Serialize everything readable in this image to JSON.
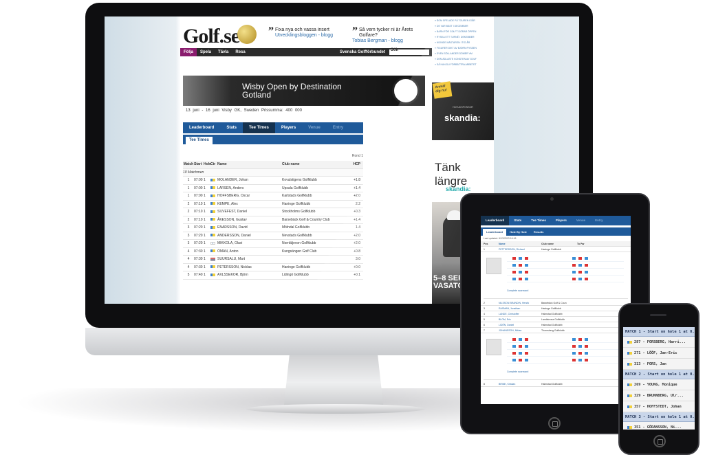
{
  "desktop": {
    "logo": "Golf.se",
    "quotes": [
      {
        "text": "Fixa nya och vassa insert",
        "sub": "Utvecklingsbloggen - blogg"
      },
      {
        "text": "Så vem tycker ni är Årets Golfare?",
        "sub": "Tobias Bergman - blogg"
      }
    ],
    "nav": [
      "Följa",
      "Spela",
      "Tävla",
      "Resa"
    ],
    "nav_right": "Svenska Golfförbundet",
    "search_placeholder": "Sök",
    "banner_title": "Wisby Open by Destination Gotland",
    "event_info": "13 juni - 16 juni    Visby GK, Sweden    Prissumma: 400 000",
    "tabs": [
      "Leaderboard",
      "Stats",
      "Tee Times",
      "Players",
      "Venue",
      "Entry"
    ],
    "active_tab": "Tee Times",
    "subtab": "Tee Times",
    "pager": "Rond 1",
    "columns": [
      "Match",
      "Start",
      "Hole",
      "Ctr",
      "Name",
      "Club name",
      "HCP"
    ],
    "group_label": "10 Matchmen",
    "rows": [
      {
        "match": "1",
        "start": "07:00",
        "hole": "1",
        "name": "MOLANDER, Johan",
        "club": "Kovulstigens Golfklubb",
        "hcp": "+1.8"
      },
      {
        "match": "1",
        "start": "07:00",
        "hole": "1",
        "name": "LARSEN, Anders",
        "club": "Upsala Golfklubb",
        "hcp": "+1.4"
      },
      {
        "match": "1",
        "start": "07:00",
        "hole": "1",
        "name": "HOFFSBERG, Oscar",
        "club": "Karlstads Golfklubb",
        "hcp": "+2.0"
      },
      {
        "match": "2",
        "start": "07:10",
        "hole": "1",
        "name": "KEMPE, Alex",
        "club": "Haninge Golfklubb",
        "hcp": "2.2"
      },
      {
        "match": "2",
        "start": "07:10",
        "hole": "1",
        "name": "SILVEFEST, Daniel",
        "club": "Stockholms Golfklubb",
        "hcp": "+0.3"
      },
      {
        "match": "2",
        "start": "07:10",
        "hole": "1",
        "name": "ÅKESSON, Gustav",
        "club": "Barsebäck Golf & Country Club",
        "hcp": "+1.4"
      },
      {
        "match": "3",
        "start": "07:20",
        "hole": "1",
        "name": "ENARSSON, David",
        "club": "Mölndal Golfklubb",
        "hcp": "1.4"
      },
      {
        "match": "3",
        "start": "07:20",
        "hole": "1",
        "name": "ANDERSSON, Daniel",
        "club": "Nevstads Golfklubb",
        "hcp": "+2.0"
      },
      {
        "match": "3",
        "start": "07:20",
        "hole": "1",
        "name": "MIKKOLA, Olavi",
        "club": "Norrtäljevon Golfklubb",
        "hcp": "+2.0"
      },
      {
        "match": "4",
        "start": "07:30",
        "hole": "1",
        "name": "ÖMAN, Anton",
        "club": "Kungsängen Golf Club",
        "hcp": "+0.8"
      },
      {
        "match": "4",
        "start": "07:30",
        "hole": "1",
        "name": "SUURSALU, Mart",
        "club": "",
        "hcp": "3.0"
      },
      {
        "match": "4",
        "start": "07:30",
        "hole": "1",
        "name": "PETERSSON, Nicklas",
        "club": "Haninge Golfklubb",
        "hcp": "+0.0"
      },
      {
        "match": "5",
        "start": "07:40",
        "hole": "1",
        "name": "AXLSSEKOR, Björn",
        "club": "Lidingö Golfklubb",
        "hcp": "+0.1"
      }
    ],
    "right_links": [
      "SOM SPELADE PÅ TOUREN IGÅR",
      "DE VAR BÄST I DECEMBER",
      "BARN FÖR GOLFT DÖRAR ÖPPEN",
      "RYSKA ETT TURNÉ I DEKEMBER",
      "NIONDE MÄSTAREN I TIO ÅR",
      "FIGURER DIKT AV BJÖRN RYSSEN",
      "SVEN SÖLLANDER DÖMER VM",
      "DEN ÄDLASTE KONSTEN AV GOLF",
      "SÅ KAN DU FÖRBÄTTRA ARBETET"
    ],
    "ads": {
      "stamp": "Anmäl dig nu!",
      "sponsor_small": "HUVUDSPONSOR",
      "sponsor": "skandia:",
      "slogan": "Tänk längre",
      "slogan_brand": "skandia:",
      "promo": "5–8 SEP VASATO"
    }
  },
  "tablet": {
    "tabs": [
      "Leaderboard",
      "Stats",
      "Tee Times",
      "Players",
      "Venue",
      "Entry"
    ],
    "subtabs": [
      "Leaderboard",
      "Hole By Hole",
      "Results"
    ],
    "updated": "Last updated: 6/13/2013 16:16",
    "columns": [
      "Pos",
      "Ctr",
      "Name",
      "Club name",
      "To Par",
      "Hole",
      "Today",
      "1",
      "2",
      "3",
      "Total"
    ],
    "top_row": {
      "pos": "1",
      "name": "PETTERSSON, Richard",
      "club": "Haninge Golfklubb"
    },
    "more_link": "Complete scorecard",
    "rows": [
      {
        "pos": "2",
        "name": "NILSSON BRANDIN, Henrik",
        "club": "Barsebäck Golf & Coun"
      },
      {
        "pos": "3",
        "name": "RASMAN, Jonathan",
        "club": "Haninge Golfklubb"
      },
      {
        "pos": "4",
        "name": "LANDE, Christoffer",
        "club": "Halmstad Golfklubb"
      },
      {
        "pos": "5",
        "name": "BLOM, Eric",
        "club": "Landskrona Golfklubb"
      },
      {
        "pos": "6",
        "name": "LIDÉN, Daniel",
        "club": "Halmstad Golfklubb"
      },
      {
        "pos": "7",
        "name": "JOHANSSON, Niklas",
        "club": "Thornsberg Golfklubb"
      }
    ],
    "bottom_row": {
      "pos": "8",
      "name": "BRINK, Kristian",
      "club": "Halmstad Golfklubb"
    }
  },
  "phone": {
    "items": [
      {
        "kind": "match",
        "text": "MATCH 1 - Start on hole 1 at 0..."
      },
      {
        "kind": "player",
        "text": "287 - FORSBERG, Harri..."
      },
      {
        "kind": "player",
        "text": "271 - LÖÖF, Jan-Eric"
      },
      {
        "kind": "player",
        "text": "313 - FORS, Jan"
      },
      {
        "kind": "match",
        "text": "MATCH 2 - Start on hole 1 at 0..."
      },
      {
        "kind": "player",
        "text": "269 - YOUNG, Monique"
      },
      {
        "kind": "player",
        "text": "329 - BRUNNBERG, Ulr..."
      },
      {
        "kind": "player",
        "text": "357 - HOFFSTEDT, Johan"
      },
      {
        "kind": "match",
        "text": "MATCH 3 - Start on hole 1 at 0..."
      },
      {
        "kind": "player",
        "text": "351 - GÖRANSSON, Ni..."
      }
    ]
  }
}
